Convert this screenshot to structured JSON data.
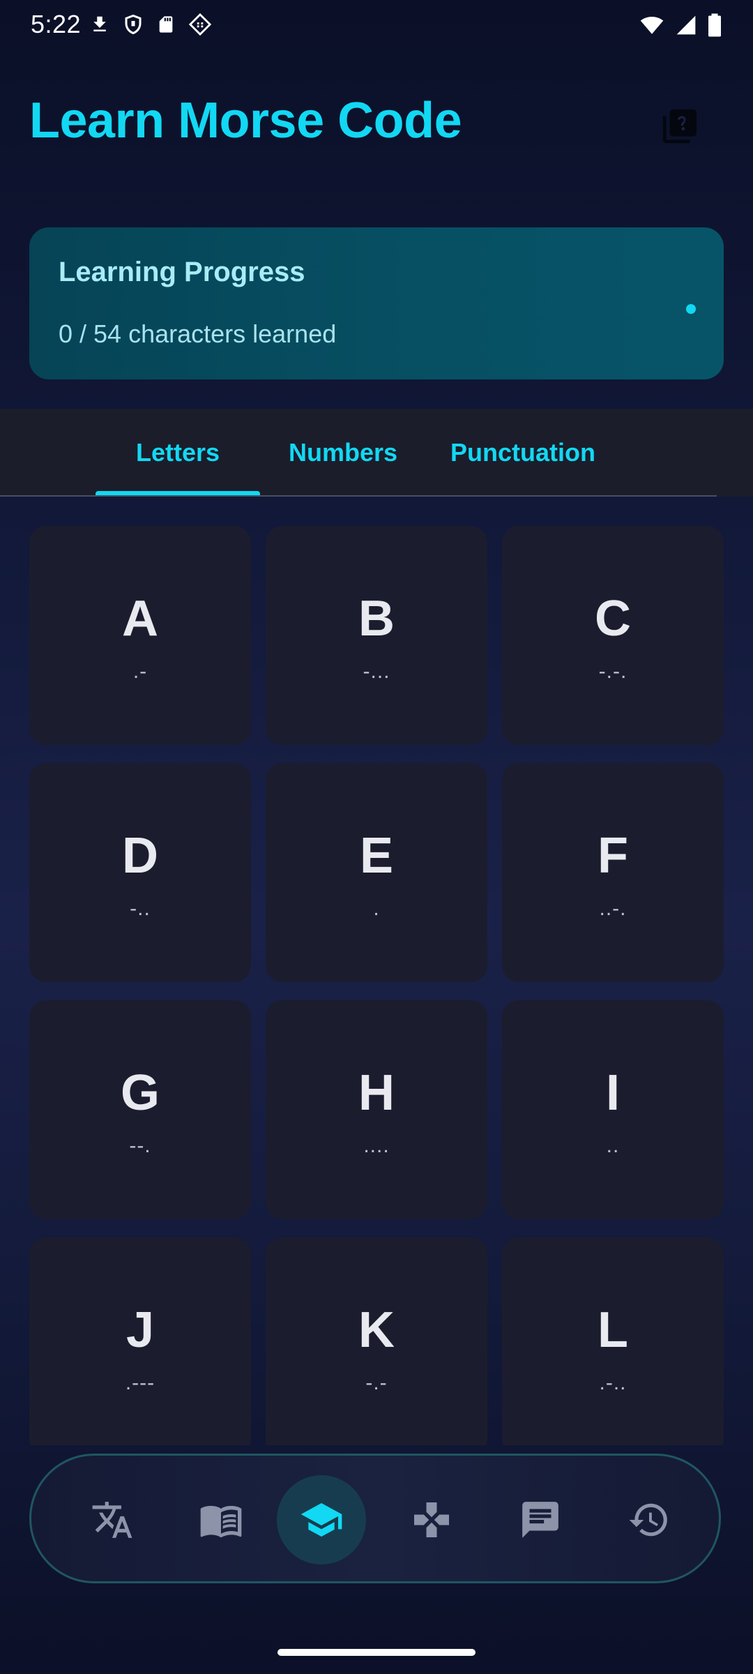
{
  "status_bar": {
    "time": "5:22",
    "left_icons": [
      "download-icon",
      "shield-icon",
      "sd-card-icon",
      "cast-icon"
    ],
    "right_icons": [
      "wifi-icon",
      "signal-icon",
      "battery-icon"
    ]
  },
  "header": {
    "title": "Learn Morse Code",
    "help_icon": "quiz-help-icon"
  },
  "progress": {
    "title": "Learning Progress",
    "subtitle": "0 / 54 characters learned",
    "learned": 0,
    "total": 54
  },
  "tabs": [
    {
      "label": "Letters",
      "selected": true
    },
    {
      "label": "Numbers",
      "selected": false
    },
    {
      "label": "Punctuation",
      "selected": false
    }
  ],
  "letters": [
    {
      "char": "A",
      "code": ".-"
    },
    {
      "char": "B",
      "code": "-..."
    },
    {
      "char": "C",
      "code": "-.-."
    },
    {
      "char": "D",
      "code": "-.."
    },
    {
      "char": "E",
      "code": "."
    },
    {
      "char": "F",
      "code": "..-."
    },
    {
      "char": "G",
      "code": "--."
    },
    {
      "char": "H",
      "code": "...."
    },
    {
      "char": "I",
      "code": ".."
    },
    {
      "char": "J",
      "code": ".---"
    },
    {
      "char": "K",
      "code": "-.-"
    },
    {
      "char": "L",
      "code": ".-.."
    }
  ],
  "bottom_nav": {
    "items": [
      {
        "icon": "translate-icon",
        "active": false
      },
      {
        "icon": "book-icon",
        "active": false
      },
      {
        "icon": "school-icon",
        "active": true
      },
      {
        "icon": "gamepad-icon",
        "active": false
      },
      {
        "icon": "chat-icon",
        "active": false
      },
      {
        "icon": "history-icon",
        "active": false
      }
    ]
  },
  "colors": {
    "accent": "#12d8f3",
    "card": "#1b1d2e",
    "progress_card": "#075064",
    "nav_icon": "#8d93a8"
  }
}
